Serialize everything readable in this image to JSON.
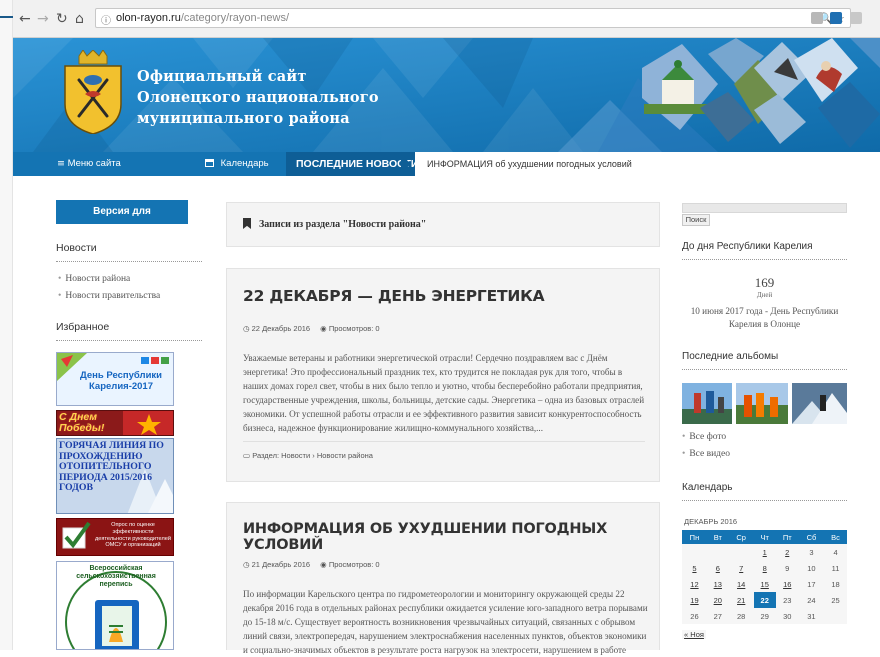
{
  "browser": {
    "info_icon": "info-icon",
    "url_domain": "olon-rayon.ru",
    "url_path": "/category/rayon-news/"
  },
  "header": {
    "title_line1": "Официальный сайт",
    "title_line2": "Олонецкого национального",
    "title_line3": "муниципального района"
  },
  "nav": {
    "menu_label": "Меню сайта",
    "calendar_label": "Календарь",
    "latest_label": "ПОСЛЕДНИЕ НОВОСТИ",
    "ticker_text": "ИНФОРМАЦИЯ об ухудшении погодных условий"
  },
  "left": {
    "accessible_button": "Версия для слабовидящих",
    "news_title": "Новости",
    "news_links": [
      "Новости района",
      "Новости правительства"
    ],
    "favorites_title": "Избранное",
    "banner1_text": "День Республики Карелия-2017",
    "banner2_text": "С Днем Победы!",
    "banner3_text": "ГОРЯЧАЯ ЛИНИЯ ПО ПРОХОЖДЕНИЮ ОТОПИТЕЛЬНОГО ПЕРИОДА 2015/2016 ГОДОВ",
    "banner4_text": "Опрос по оценке эффективности деятельности руководителей ОМСУ и организаций",
    "banner5_text": "Всероссийская сельскохозяйственная перепись"
  },
  "main": {
    "section_heading": "Записи из раздела \"Новости района\"",
    "posts": [
      {
        "title": "22 ДЕКАБРЯ — ДЕНЬ ЭНЕРГЕТИКА",
        "date": "22 Декабрь 2016",
        "views": "Просмотров: 0",
        "excerpt": "Уважаемые ветераны и работники энергетической отрасли! Сердечно поздравляем вас с Днём энергетика! Это профессиональный праздник тех, кто трудится не покладая рук для того, чтобы в наших домах горел свет, чтобы в них было тепло и уютно, чтобы бесперебойно работали предприятия, государственные учреждения, школы, больницы, детские сады. Энергетика – одна из базовых отраслей экономики. От успешной работы отрасли и ее эффективного развития зависит конкурентоспособность бизнеса, надежное функционирование жилищно-коммунального хозяйства,...",
        "category": "Раздел: Новости › Новости района"
      },
      {
        "title": "ИНФОРМАЦИЯ ОБ УХУДШЕНИИ ПОГОДНЫХ УСЛОВИЙ",
        "date": "21 Декабрь 2016",
        "views": "Просмотров: 0",
        "excerpt": "По информации Карельского центра по гидрометеорологии и мониторингу окружающей среды 22 декабря 2016 года в отдельных районах республики ожидается усиление юго-западного ветра порывами до 15-18 м/с. Существует вероятность возникновения чрезвычайных ситуаций, связанных с обрывом линий связи, электропередач, нарушением электроснабжения населенных пунктов, объектов экономики и социально-значимых объектов в результате роста нагрузок на электросети, нарушением в работе"
      }
    ]
  },
  "right": {
    "search_button": "Поиск",
    "countdown_title": "До дня Республики Карелия",
    "countdown_value": "169",
    "countdown_unit": "Дней",
    "countdown_desc": "10 июня 2017 года - День Республики Карелия в Олонце",
    "albums_title": "Последние альбомы",
    "album_links": [
      "Все фото",
      "Все видео"
    ],
    "calendar_title": "Календарь",
    "calendar_month": "ДЕКАБРЬ 2016",
    "weekdays": [
      "Пн",
      "Вт",
      "Ср",
      "Чт",
      "Пт",
      "Сб",
      "Вс"
    ],
    "weeks": [
      [
        "",
        "",
        "",
        "1",
        "2",
        "3",
        "4"
      ],
      [
        "5",
        "6",
        "7",
        "8",
        "9",
        "10",
        "11"
      ],
      [
        "12",
        "13",
        "14",
        "15",
        "16",
        "17",
        "18"
      ],
      [
        "19",
        "20",
        "21",
        "22",
        "23",
        "24",
        "25"
      ],
      [
        "26",
        "27",
        "28",
        "29",
        "30",
        "31",
        ""
      ]
    ],
    "linked_days": [
      "1",
      "2",
      "5",
      "6",
      "7",
      "8",
      "12",
      "13",
      "14",
      "15",
      "16",
      "19",
      "20",
      "21"
    ],
    "today": "22",
    "prev_month": "« Ноя"
  }
}
